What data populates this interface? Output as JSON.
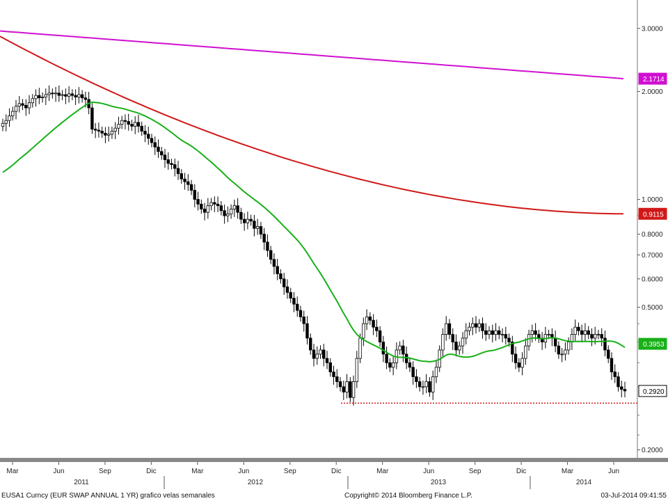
{
  "chart_data": {
    "type": "candlestick",
    "scale": "log",
    "ylim": [
      0.19,
      3.6
    ],
    "y_ticks": [
      "3.0000",
      "2.0000",
      "1.0000",
      "0.8000",
      "0.7000",
      "0.6000",
      "0.5000",
      "0.2000"
    ],
    "x_month_labels": [
      "Mar",
      "Jun",
      "Sep",
      "Dic",
      "Mar",
      "Jun",
      "Sep",
      "Dic",
      "Mar",
      "Jun",
      "Sep",
      "Dic",
      "Mar",
      "Jun"
    ],
    "x_year_labels": [
      "2011",
      "2012",
      "2013",
      "2014"
    ],
    "price_weekly_close": [
      1.63,
      1.66,
      1.71,
      1.76,
      1.82,
      1.85,
      1.83,
      1.8,
      1.86,
      1.91,
      1.95,
      1.92,
      1.93,
      1.96,
      1.98,
      1.97,
      1.98,
      1.95,
      1.96,
      1.94,
      1.97,
      1.95,
      1.93,
      1.96,
      1.92,
      1.9,
      1.8,
      1.57,
      1.56,
      1.55,
      1.53,
      1.51,
      1.52,
      1.55,
      1.58,
      1.62,
      1.66,
      1.65,
      1.62,
      1.6,
      1.64,
      1.6,
      1.55,
      1.52,
      1.48,
      1.44,
      1.4,
      1.36,
      1.33,
      1.29,
      1.26,
      1.25,
      1.22,
      1.18,
      1.14,
      1.12,
      1.1,
      1.06,
      1.0,
      0.97,
      0.94,
      0.92,
      0.96,
      0.98,
      0.97,
      0.96,
      0.93,
      0.9,
      0.91,
      0.94,
      0.96,
      0.92,
      0.88,
      0.86,
      0.88,
      0.87,
      0.83,
      0.84,
      0.8,
      0.76,
      0.72,
      0.68,
      0.65,
      0.62,
      0.6,
      0.57,
      0.55,
      0.53,
      0.51,
      0.49,
      0.47,
      0.45,
      0.41,
      0.38,
      0.36,
      0.37,
      0.38,
      0.36,
      0.35,
      0.33,
      0.32,
      0.31,
      0.3,
      0.29,
      0.31,
      0.28,
      0.31,
      0.36,
      0.41,
      0.45,
      0.47,
      0.46,
      0.44,
      0.43,
      0.4,
      0.37,
      0.35,
      0.34,
      0.35,
      0.38,
      0.39,
      0.37,
      0.35,
      0.34,
      0.32,
      0.31,
      0.3,
      0.3,
      0.31,
      0.29,
      0.32,
      0.34,
      0.38,
      0.42,
      0.45,
      0.42,
      0.4,
      0.38,
      0.39,
      0.41,
      0.43,
      0.44,
      0.45,
      0.44,
      0.45,
      0.43,
      0.42,
      0.43,
      0.42,
      0.43,
      0.42,
      0.42,
      0.41,
      0.4,
      0.37,
      0.35,
      0.34,
      0.36,
      0.39,
      0.42,
      0.43,
      0.42,
      0.41,
      0.4,
      0.42,
      0.42,
      0.41,
      0.39,
      0.37,
      0.37,
      0.38,
      0.4,
      0.42,
      0.44,
      0.43,
      0.42,
      0.43,
      0.42,
      0.41,
      0.42,
      0.42,
      0.41,
      0.38,
      0.36,
      0.33,
      0.32,
      0.3,
      0.295,
      0.292
    ],
    "series": [
      {
        "name": "",
        "color": "#d01818",
        "label": "0.9115",
        "start": 2.85,
        "end": 0.9115
      },
      {
        "name": "",
        "color": "#d010d0",
        "label": "2.1714",
        "start": 2.95,
        "end": 2.1714
      },
      {
        "name": "",
        "color": "#18b018",
        "label": "0.3953",
        "last": 0.3953
      },
      {
        "name": "",
        "color": "#000000",
        "label": "0.2920",
        "last": 0.292
      }
    ],
    "support_level": 0.27
  },
  "footer": {
    "left": "EUSA1 Curncy (EUR SWAP ANNUAL   1 YR) grafico velas semanales",
    "center": "Copyright© 2014 Bloomberg Finance L.P.",
    "right": "03-Jul-2014  09:41:55"
  },
  "colors": {
    "grid": "#888888",
    "bg": "#ffffff"
  }
}
